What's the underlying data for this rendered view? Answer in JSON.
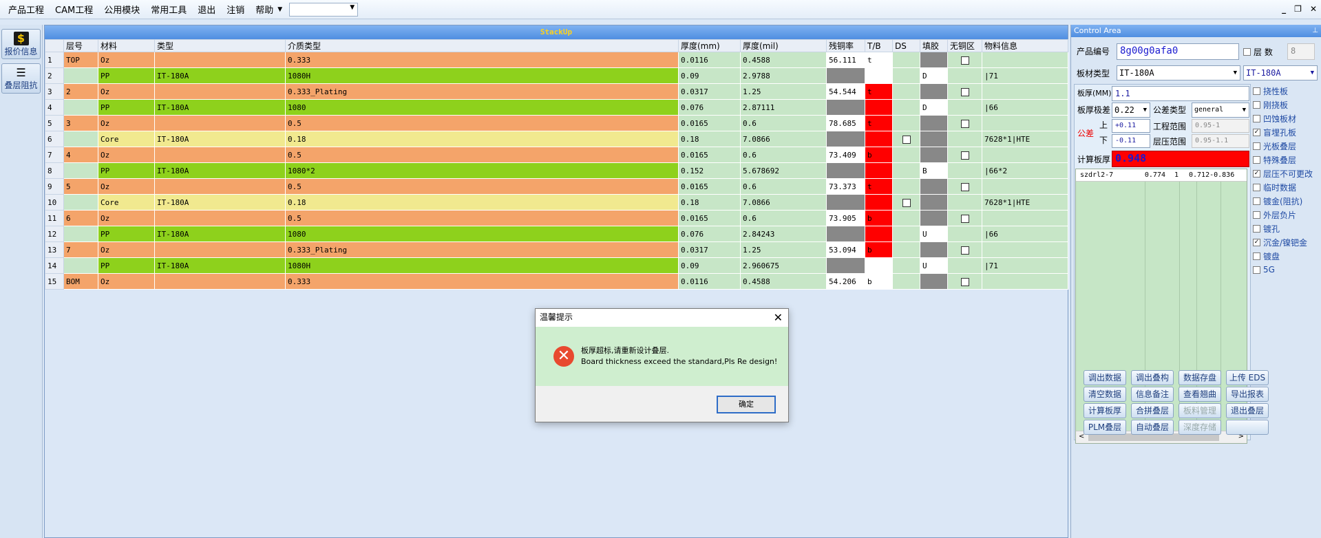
{
  "menu": {
    "items": [
      "产品工程",
      "CAM工程",
      "公用模块",
      "常用工具",
      "退出",
      "注销",
      "帮助"
    ],
    "combo_value": ""
  },
  "window_buttons": [
    "_",
    "❐",
    "✕"
  ],
  "left_nav": [
    {
      "label": "报价信息",
      "icon": "dollar-icon"
    },
    {
      "label": "叠层阻抗",
      "icon": "layers-icon"
    }
  ],
  "stackup": {
    "title": "StackUp",
    "columns": [
      "层号",
      "材料",
      "类型",
      "介质类型",
      "厚度(mm)",
      "厚度(mil)",
      "残铜率",
      "T/B",
      "DS",
      "填胶",
      "无铜区",
      "物料信息"
    ],
    "rows": [
      {
        "n": "1",
        "layer": "TOP",
        "material": "Oz",
        "type": "",
        "dielectric": "0.333",
        "mm": "0.0116",
        "mil": "0.4588",
        "res": "56.111",
        "tb": "t",
        "fill": "",
        "info": "",
        "kind": "oz",
        "res_style": "white",
        "tb_style": "white",
        "fill_style": "gray",
        "cb": "nocu"
      },
      {
        "n": "2",
        "layer": "",
        "material": "PP",
        "type": "IT-180A",
        "dielectric": "1080H",
        "mm": "0.09",
        "mil": "2.9788",
        "res": "",
        "tb": "",
        "fill": "D",
        "info": "|71",
        "kind": "pp",
        "res_style": "gray",
        "tb_style": "white",
        "fill_style": "white",
        "cb": ""
      },
      {
        "n": "3",
        "layer": "2",
        "material": "Oz",
        "type": "",
        "dielectric": "0.333_Plating",
        "mm": "0.0317",
        "mil": "1.25",
        "res": "54.544",
        "tb": "t",
        "fill": "",
        "info": "",
        "kind": "oz",
        "res_style": "white",
        "tb_style": "red",
        "fill_style": "gray",
        "cb": "nocu"
      },
      {
        "n": "4",
        "layer": "",
        "material": "PP",
        "type": "IT-180A",
        "dielectric": "1080",
        "mm": "0.076",
        "mil": "2.87111",
        "res": "",
        "tb": "",
        "fill": "D",
        "info": "|66",
        "kind": "pp",
        "res_style": "gray",
        "tb_style": "red",
        "fill_style": "white",
        "cb": ""
      },
      {
        "n": "5",
        "layer": "3",
        "material": "Oz",
        "type": "",
        "dielectric": "0.5",
        "mm": "0.0165",
        "mil": "0.6",
        "res": "78.685",
        "tb": "t",
        "fill": "",
        "info": "",
        "kind": "oz",
        "res_style": "white",
        "tb_style": "red",
        "fill_style": "gray",
        "cb": "nocu"
      },
      {
        "n": "6",
        "layer": "",
        "material": "Core",
        "type": "IT-180A",
        "dielectric": "0.18",
        "mm": "0.18",
        "mil": "7.0866",
        "res": "",
        "tb": "",
        "fill": "",
        "info": "7628*1|HTE",
        "kind": "core",
        "res_style": "gray",
        "tb_style": "red",
        "fill_style": "gray",
        "cb": "ds"
      },
      {
        "n": "7",
        "layer": "4",
        "material": "Oz",
        "type": "",
        "dielectric": "0.5",
        "mm": "0.0165",
        "mil": "0.6",
        "res": "73.409",
        "tb": "b",
        "fill": "",
        "info": "",
        "kind": "oz",
        "res_style": "white",
        "tb_style": "red",
        "fill_style": "gray",
        "cb": "nocu"
      },
      {
        "n": "8",
        "layer": "",
        "material": "PP",
        "type": "IT-180A",
        "dielectric": "1080*2",
        "mm": "0.152",
        "mil": "5.678692",
        "res": "",
        "tb": "",
        "fill": "B",
        "info": "|66*2",
        "kind": "pp",
        "res_style": "gray",
        "tb_style": "red",
        "fill_style": "white",
        "cb": ""
      },
      {
        "n": "9",
        "layer": "5",
        "material": "Oz",
        "type": "",
        "dielectric": "0.5",
        "mm": "0.0165",
        "mil": "0.6",
        "res": "73.373",
        "tb": "t",
        "fill": "",
        "info": "",
        "kind": "oz",
        "res_style": "white",
        "tb_style": "red",
        "fill_style": "gray",
        "cb": "nocu"
      },
      {
        "n": "10",
        "layer": "",
        "material": "Core",
        "type": "IT-180A",
        "dielectric": "0.18",
        "mm": "0.18",
        "mil": "7.0866",
        "res": "",
        "tb": "",
        "fill": "",
        "info": "7628*1|HTE",
        "kind": "core",
        "res_style": "gray",
        "tb_style": "red",
        "fill_style": "gray",
        "cb": "ds"
      },
      {
        "n": "11",
        "layer": "6",
        "material": "Oz",
        "type": "",
        "dielectric": "0.5",
        "mm": "0.0165",
        "mil": "0.6",
        "res": "73.905",
        "tb": "b",
        "fill": "",
        "info": "",
        "kind": "oz",
        "res_style": "white",
        "tb_style": "red",
        "fill_style": "gray",
        "cb": "nocu"
      },
      {
        "n": "12",
        "layer": "",
        "material": "PP",
        "type": "IT-180A",
        "dielectric": "1080",
        "mm": "0.076",
        "mil": "2.84243",
        "res": "",
        "tb": "",
        "fill": "U",
        "info": "|66",
        "kind": "pp",
        "res_style": "gray",
        "tb_style": "red",
        "fill_style": "white",
        "cb": ""
      },
      {
        "n": "13",
        "layer": "7",
        "material": "Oz",
        "type": "",
        "dielectric": "0.333_Plating",
        "mm": "0.0317",
        "mil": "1.25",
        "res": "53.094",
        "tb": "b",
        "fill": "",
        "info": "",
        "kind": "oz",
        "res_style": "white",
        "tb_style": "red",
        "fill_style": "gray",
        "cb": "nocu"
      },
      {
        "n": "14",
        "layer": "",
        "material": "PP",
        "type": "IT-180A",
        "dielectric": "1080H",
        "mm": "0.09",
        "mil": "2.960675",
        "res": "",
        "tb": "",
        "fill": "U",
        "info": "|71",
        "kind": "pp",
        "res_style": "gray",
        "tb_style": "white",
        "fill_style": "white",
        "cb": ""
      },
      {
        "n": "15",
        "layer": "BOM",
        "material": "Oz",
        "type": "",
        "dielectric": "0.333",
        "mm": "0.0116",
        "mil": "0.4588",
        "res": "54.206",
        "tb": "b",
        "fill": "",
        "info": "",
        "kind": "oz",
        "res_style": "white",
        "tb_style": "white",
        "fill_style": "gray",
        "cb": "nocu"
      }
    ]
  },
  "dialog": {
    "title": "温馨提示",
    "close": "✕",
    "message_cn": "板厚超标,请重新设计叠层.",
    "message_en": "Board thickness exceed the standard,Pls Re design!",
    "ok_label": "确定"
  },
  "control": {
    "title": "Control Area",
    "pin": "📌",
    "product_no_label": "产品编号",
    "product_no": "8g00g0afa0",
    "layer_cnt_label": "层  数",
    "layer_cnt": "8",
    "material_label": "板材类型",
    "material": "IT-180A",
    "material2": "IT-180A",
    "thickness_label": "板厚(MM)",
    "thickness": "1.1",
    "tol_label": "板厚极差",
    "tol": "0.22",
    "tol_type_label": "公差类型",
    "tol_type": "general",
    "gongcha_label": "公差",
    "up_label": "上",
    "down_label": "下",
    "up": "+0.11",
    "down": "-0.11",
    "eng_range_label": "工程范围",
    "eng_range": "0.95-1",
    "press_range_label": "层压范围",
    "press_range": "0.95-1.1",
    "calc_label": "计算板厚",
    "calc": "0.948",
    "list_row": [
      "szdrl2-7",
      "0.774",
      "1",
      "0.712-0.836"
    ],
    "checks": [
      {
        "label": "挠性板",
        "checked": false
      },
      {
        "label": "刚挠板",
        "checked": false
      },
      {
        "label": "凹蚀板材",
        "checked": false
      },
      {
        "label": "盲埋孔板",
        "checked": true
      },
      {
        "label": "光板叠层",
        "checked": false
      },
      {
        "label": "特殊叠层",
        "checked": false
      },
      {
        "label": "层压不可更改",
        "checked": true
      },
      {
        "label": "临时数据",
        "checked": false
      },
      {
        "label": "镀金(阻抗)",
        "checked": false
      },
      {
        "label": "外层负片",
        "checked": false
      },
      {
        "label": "镀孔",
        "checked": false
      },
      {
        "label": "沉金/镍钯金",
        "checked": true
      },
      {
        "label": "镀盘",
        "checked": false
      },
      {
        "label": "5G",
        "checked": false
      }
    ],
    "buttons": [
      [
        "调出数据",
        "调出叠构",
        "数据存盘",
        "上传 EDS"
      ],
      [
        "清空数据",
        "信息备注",
        "查看翘曲",
        "导出报表"
      ],
      [
        "计算板厚",
        "合拼叠层",
        "板料管理",
        "退出叠层"
      ],
      [
        "PLM叠层",
        "自动叠层",
        "深度存储",
        ""
      ]
    ]
  },
  "colors": {
    "oz": "#f4a46a",
    "pp": "#8ed11c",
    "core": "#f1e98f",
    "light_green": "#c7e6c7",
    "gray_cell": "#888888",
    "red_cell": "#ff0000",
    "title_text": "#ffd21a"
  }
}
